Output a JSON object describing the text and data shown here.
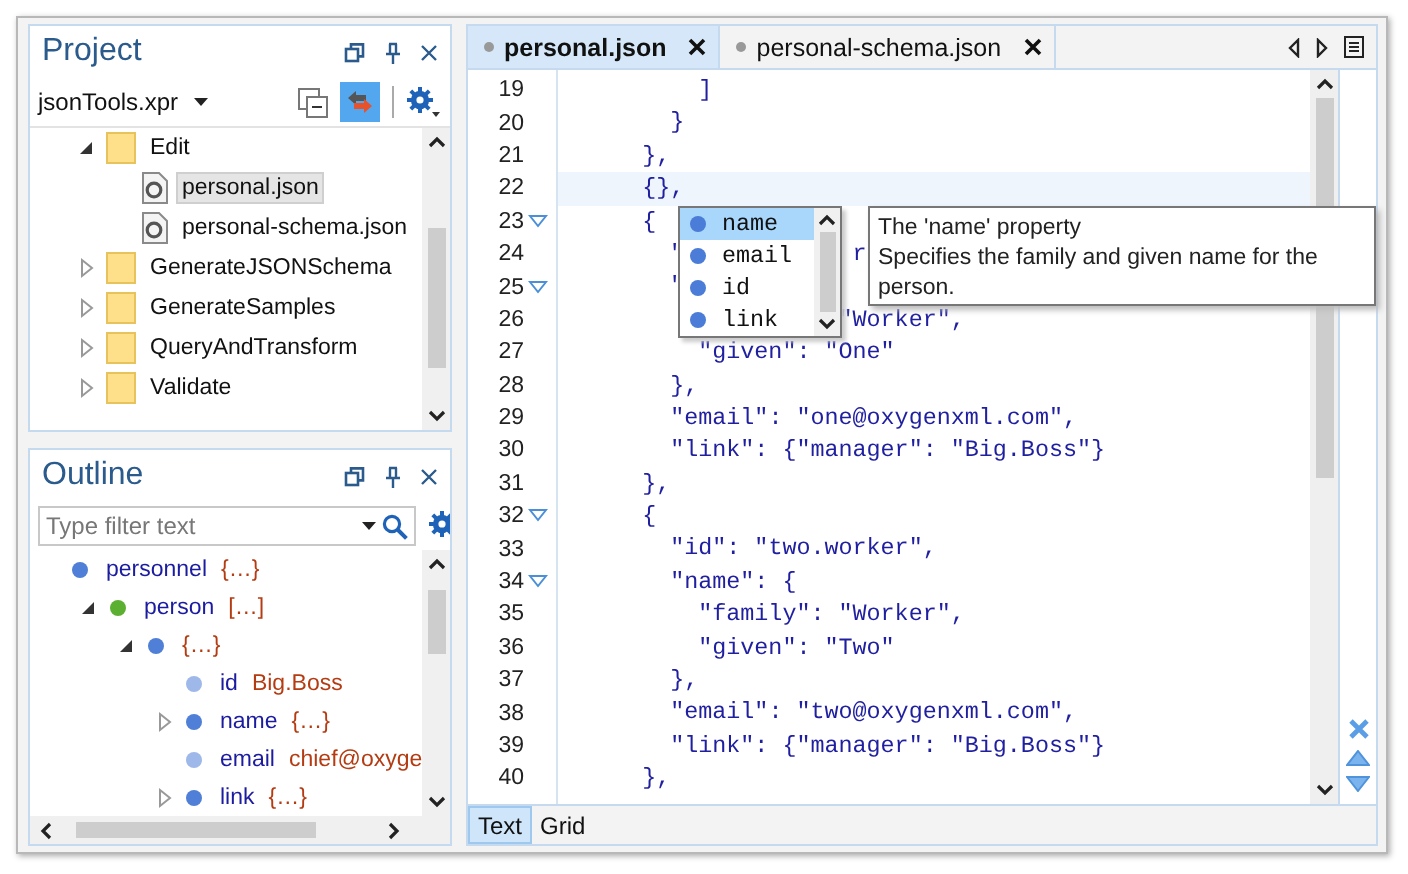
{
  "project": {
    "title": "Project",
    "file_selector": "jsonTools.xpr",
    "items": [
      {
        "label": "Edit",
        "kind": "folder",
        "expanded": true,
        "selected": false,
        "children": [
          {
            "label": "personal.json",
            "kind": "file",
            "selected": true
          },
          {
            "label": "personal-schema.json",
            "kind": "file",
            "selected": false
          }
        ]
      },
      {
        "label": "GenerateJSONSchema",
        "kind": "folder",
        "expanded": false,
        "selected": false
      },
      {
        "label": "GenerateSamples",
        "kind": "folder",
        "expanded": false,
        "selected": false
      },
      {
        "label": "QueryAndTransform",
        "kind": "folder",
        "expanded": false,
        "selected": false
      },
      {
        "label": "Validate",
        "kind": "folder",
        "expanded": false,
        "selected": false
      }
    ]
  },
  "outline": {
    "title": "Outline",
    "filter": {
      "placeholder": "Type filter text"
    },
    "items": [
      {
        "key": "personnel",
        "value": "{…}",
        "color": "#4f7fd6",
        "children": [
          {
            "key": "person",
            "value": "[…]",
            "color": "#5cb031",
            "expanded": true,
            "children": [
              {
                "value": "{…}",
                "color": "#4f7fd6",
                "expanded": true,
                "children": [
                  {
                    "key": "id",
                    "value": "Big.Boss",
                    "color": "#9fb8ea"
                  },
                  {
                    "key": "name",
                    "value": "{…}",
                    "color": "#4f7fd6",
                    "expanded": false
                  },
                  {
                    "key": "email",
                    "value": "chief@oxyge",
                    "color": "#9fb8ea"
                  },
                  {
                    "key": "link",
                    "value": "{…}",
                    "color": "#4f7fd6",
                    "expanded": false
                  }
                ]
              }
            ]
          }
        ]
      }
    ]
  },
  "editor": {
    "tabs": [
      {
        "label": "personal.json",
        "selected": true
      },
      {
        "label": "personal-schema.json",
        "selected": false
      }
    ],
    "lines": [
      {
        "number": "19",
        "code": "        ]",
        "current": false,
        "foldable": false
      },
      {
        "number": "20",
        "code": "      }",
        "current": false,
        "foldable": false
      },
      {
        "number": "21",
        "code": "    },",
        "current": false,
        "foldable": false
      },
      {
        "number": "22",
        "code": "    {},",
        "current": true,
        "foldable": false
      },
      {
        "number": "23",
        "code": "    {",
        "current": false,
        "foldable": true
      },
      {
        "number": "24",
        "code": "      \"            r",
        "current": false,
        "foldable": false
      },
      {
        "number": "25",
        "code": "      \"",
        "current": false,
        "foldable": true
      },
      {
        "number": "26",
        "code": "                  \"Worker\",",
        "current": false,
        "foldable": false
      },
      {
        "number": "27",
        "code": "        \"given\": \"One\"",
        "current": false,
        "foldable": false
      },
      {
        "number": "28",
        "code": "      },",
        "current": false,
        "foldable": false
      },
      {
        "number": "29",
        "code": "      \"email\": \"one@oxygenxml.com\",",
        "current": false,
        "foldable": false
      },
      {
        "number": "30",
        "code": "      \"link\": {\"manager\": \"Big.Boss\"}",
        "current": false,
        "foldable": false
      },
      {
        "number": "31",
        "code": "    },",
        "current": false,
        "foldable": false
      },
      {
        "number": "32",
        "code": "    {",
        "current": false,
        "foldable": true
      },
      {
        "number": "33",
        "code": "      \"id\": \"two.worker\",",
        "current": false,
        "foldable": false
      },
      {
        "number": "34",
        "code": "      \"name\": {",
        "current": false,
        "foldable": true
      },
      {
        "number": "35",
        "code": "        \"family\": \"Worker\",",
        "current": false,
        "foldable": false
      },
      {
        "number": "36",
        "code": "        \"given\": \"Two\"",
        "current": false,
        "foldable": false
      },
      {
        "number": "37",
        "code": "      },",
        "current": false,
        "foldable": false
      },
      {
        "number": "38",
        "code": "      \"email\": \"two@oxygenxml.com\",",
        "current": false,
        "foldable": false
      },
      {
        "number": "39",
        "code": "      \"link\": {\"manager\": \"Big.Boss\"}",
        "current": false,
        "foldable": false
      },
      {
        "number": "40",
        "code": "    },",
        "current": false,
        "foldable": false
      }
    ],
    "completion": {
      "items": [
        {
          "label": "name",
          "selected": true
        },
        {
          "label": "email",
          "selected": false
        },
        {
          "label": "id",
          "selected": false
        },
        {
          "label": "link",
          "selected": false
        }
      ],
      "tooltip": {
        "title": "The 'name' property",
        "description": "Specifies the family and given name for the person."
      }
    },
    "mode_tabs": [
      {
        "label": "Text",
        "selected": true
      },
      {
        "label": "Grid",
        "selected": false
      }
    ]
  }
}
